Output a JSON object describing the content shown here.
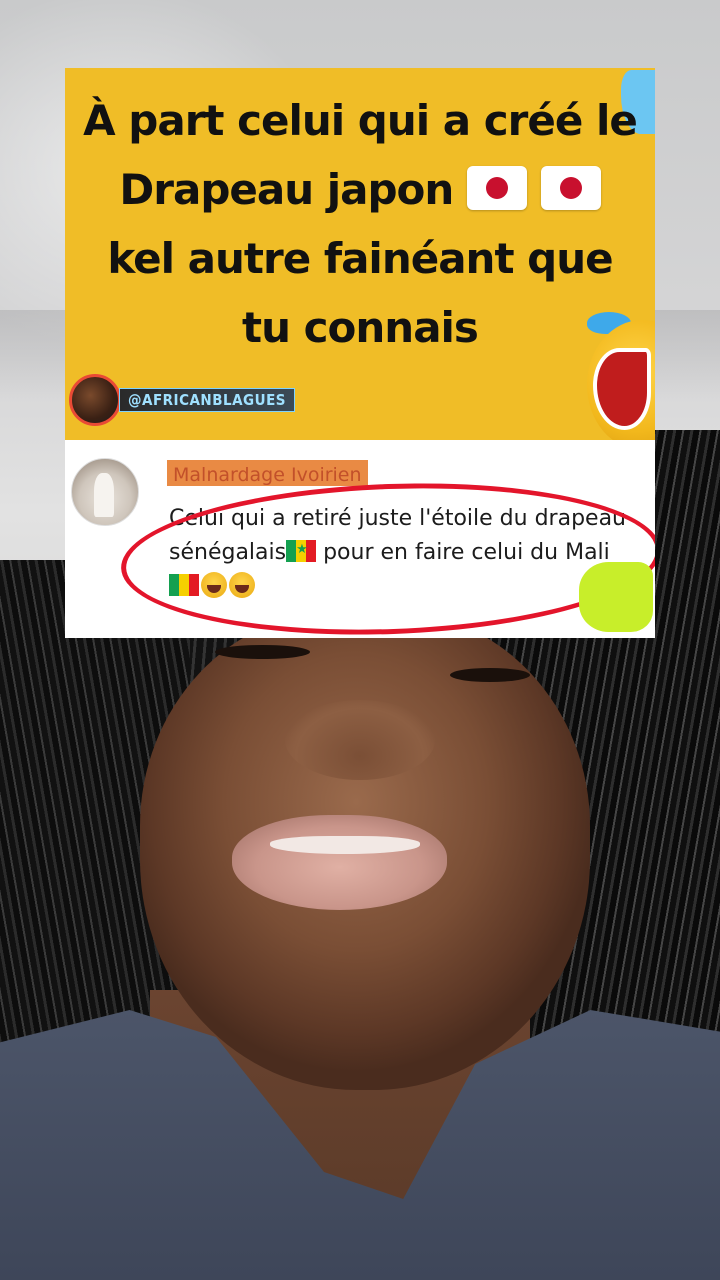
{
  "meme": {
    "title_part1": "À part celui qui a créé le Drapeau japon",
    "title_part2": "kel autre fainéant que tu connais",
    "watermark_handle": "@AFRICANBLAGUES"
  },
  "comment": {
    "author": "Malnardage Ivoirien",
    "text_part1": "Celui qui a retiré juste l'étoile du drapeau sénégalais",
    "text_part2": " pour en faire celui du Mali"
  },
  "icons": [
    "japan-flag-icon",
    "senegal-flag-icon",
    "mali-flag-icon",
    "laughing-emoji-icon"
  ],
  "colors": {
    "meme_background": "#f0bd27",
    "highlight_ring": "#e3152b",
    "author_tag": "#e98a44"
  }
}
